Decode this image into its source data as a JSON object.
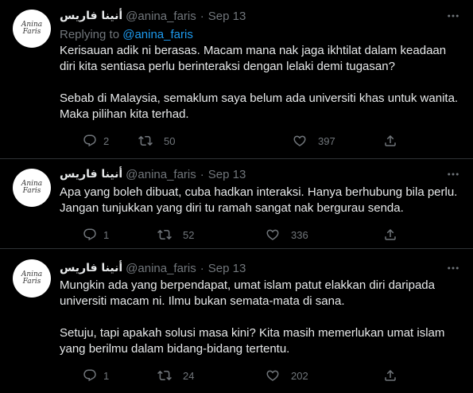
{
  "tweets": [
    {
      "author_name": "أنينا فاريس",
      "handle": "@anina_faris",
      "separator": "·",
      "date": "Sep 13",
      "replying_to_prefix": "Replying to",
      "replying_to_handle": "@anina_faris",
      "lines": [
        "Kerisauan adik ni berasas. Macam mana nak jaga ikhtilat dalam keadaan",
        "diri kita sentiasa perlu berinteraksi dengan lelaki demi tugasan?",
        "",
        "Sebab di Malaysia, semaklum saya belum ada universiti khas untuk wanita.",
        "Maka pilihan kita terhad."
      ],
      "replies": "2",
      "retweets": "50",
      "likes": "397"
    },
    {
      "author_name": "أنينا فاريس",
      "handle": "@anina_faris",
      "separator": "·",
      "date": "Sep 13",
      "lines": [
        "Apa yang boleh dibuat, cuba hadkan interaksi. Hanya berhubung bila perlu.",
        "Jangan tunjukkan yang diri tu ramah sangat nak bergurau senda."
      ],
      "replies": "1",
      "retweets": "52",
      "likes": "336"
    },
    {
      "author_name": "أنينا فاريس",
      "handle": "@anina_faris",
      "separator": "·",
      "date": "Sep 13",
      "lines": [
        "Mungkin ada yang berpendapat, umat islam patut elakkan diri daripada",
        "universiti macam ni. Ilmu bukan semata-mata di sana.",
        "",
        "Setuju, tapi apakah solusi masa kini? Kita masih memerlukan umat islam",
        "yang berilmu dalam bidang-bidang tertentu."
      ],
      "replies": "1",
      "retweets": "24",
      "likes": "202"
    }
  ],
  "avatar_text": "Anina Faris",
  "icons": {
    "reply": "reply-icon",
    "retweet": "retweet-icon",
    "like": "heart-icon",
    "share": "share-icon",
    "more": "more-icon"
  },
  "colors": {
    "background": "#000000",
    "text": "#e7e9ea",
    "secondary": "#71767b",
    "link": "#1d9bf0",
    "divider": "#2f3336"
  }
}
